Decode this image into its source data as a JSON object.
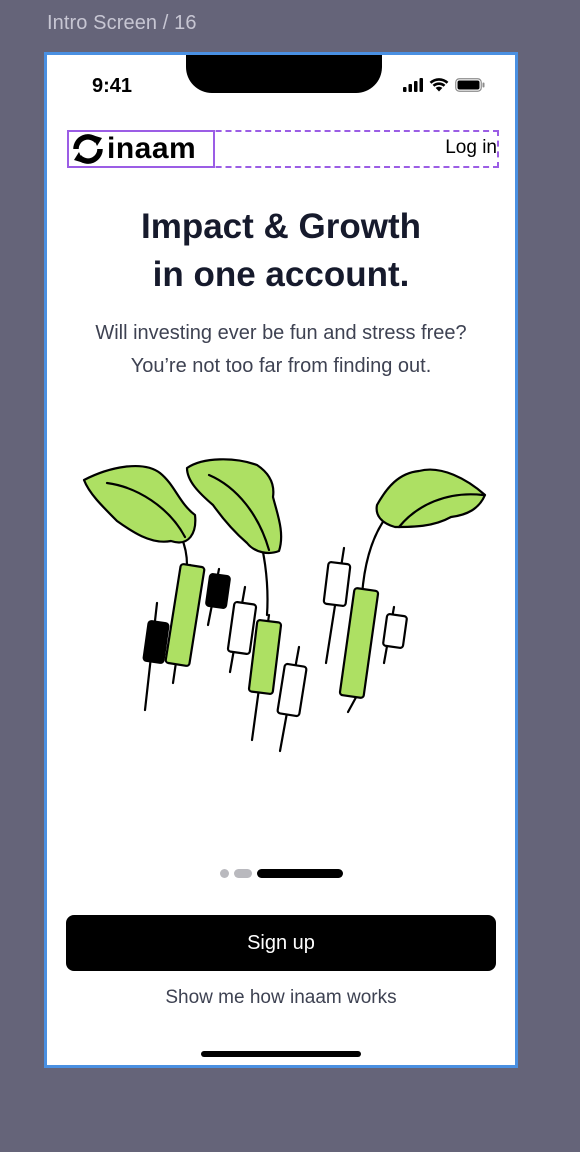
{
  "canvas": {
    "frame_label": "Intro Screen / 16"
  },
  "status_bar": {
    "time": "9:41",
    "icons": [
      "cellular-signal-icon",
      "wifi-icon",
      "battery-icon"
    ]
  },
  "header": {
    "logo_text": "inaam",
    "login_label": "Log in"
  },
  "hero": {
    "headline_line1": "Impact & Growth",
    "headline_line2": "in one account.",
    "subtitle_line1": "Will investing ever be fun and stress free?",
    "subtitle_line2": "You’re not too far from finding out."
  },
  "illustration": {
    "icon": "plant-candlestick-illustration",
    "leaf_color": "#ade063",
    "outline_color": "#000000"
  },
  "pagination": {
    "total": 3,
    "active_index": 2
  },
  "actions": {
    "signup_label": "Sign up",
    "howto_label": "Show me how inaam works"
  },
  "colors": {
    "background": "#656479",
    "frame_border": "#4a90e2",
    "selection": "#9b5de5",
    "accent_green": "#ade063",
    "text_dark": "#161a2c",
    "text_muted": "#3e4252"
  }
}
